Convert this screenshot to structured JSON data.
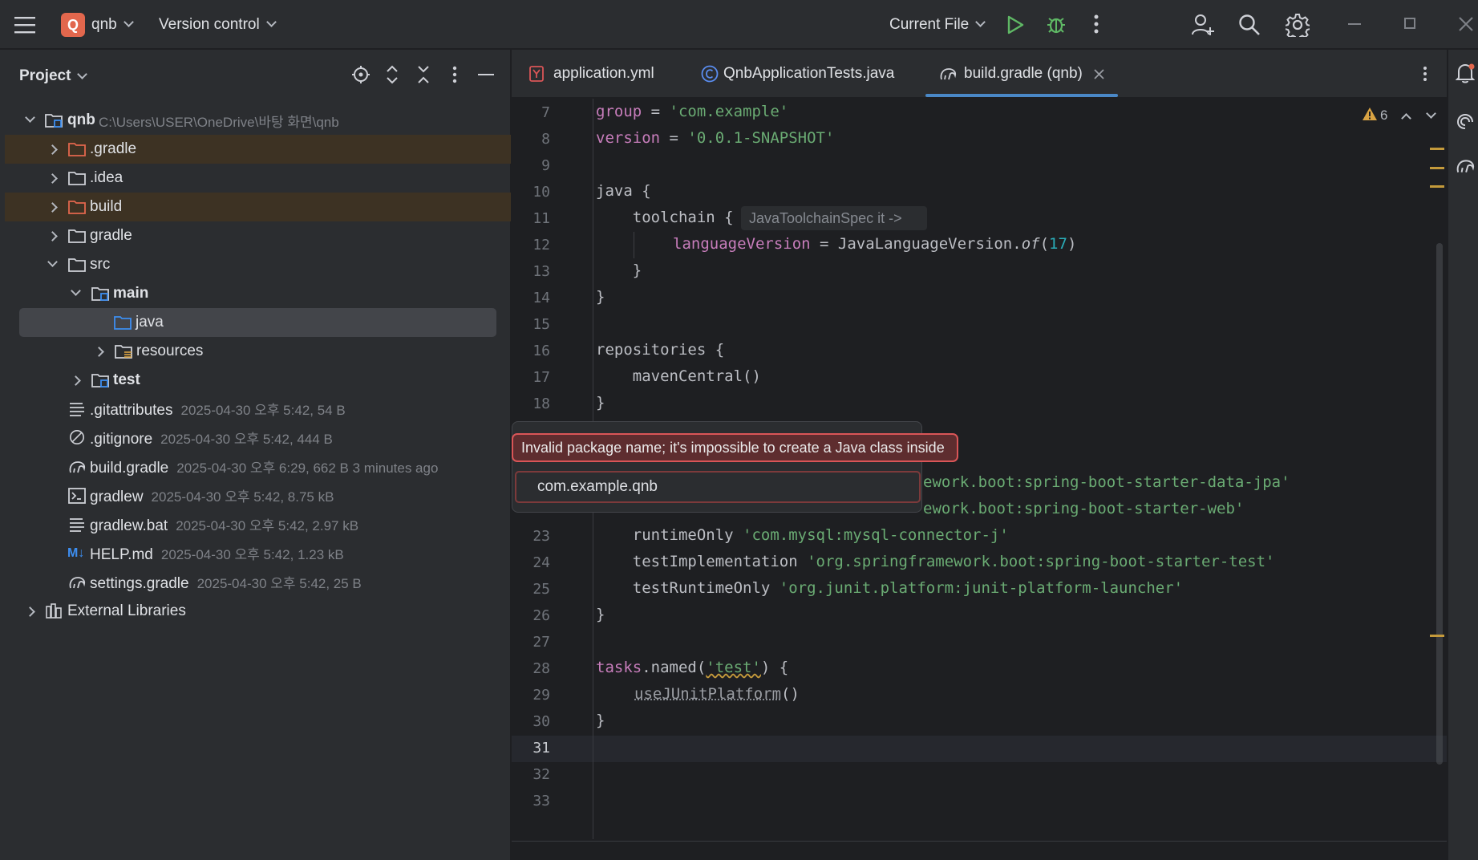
{
  "titlebar": {
    "project_initial": "Q",
    "project_name": "qnb",
    "version_control": "Version control",
    "run_config": "Current File"
  },
  "project_panel": {
    "title": "Project",
    "root": {
      "name": "qnb",
      "path": "C:\\Users\\USER\\OneDrive\\바탕 화면\\qnb"
    },
    "items": [
      {
        "label": ".gradle"
      },
      {
        "label": ".idea"
      },
      {
        "label": "build"
      },
      {
        "label": "gradle"
      },
      {
        "label": "src"
      },
      {
        "label": "main"
      },
      {
        "label": "java"
      },
      {
        "label": "resources"
      },
      {
        "label": "test"
      },
      {
        "label": ".gitattributes",
        "meta": "2025-04-30 오후 5:42, 54 B"
      },
      {
        "label": ".gitignore",
        "meta": "2025-04-30 오후 5:42, 444 B"
      },
      {
        "label": "build.gradle",
        "meta": "2025-04-30 오후 6:29, 662 B 3 minutes ago"
      },
      {
        "label": "gradlew",
        "meta": "2025-04-30 오후 5:42, 8.75 kB"
      },
      {
        "label": "gradlew.bat",
        "meta": "2025-04-30 오후 5:42, 2.97 kB"
      },
      {
        "label": "HELP.md",
        "meta": "2025-04-30 오후 5:42, 1.23 kB"
      },
      {
        "label": "settings.gradle",
        "meta": "2025-04-30 오후 5:42, 25 B"
      },
      {
        "label": "External Libraries"
      }
    ],
    "md_badge": "M↓"
  },
  "tabs": [
    {
      "label": "application.yml"
    },
    {
      "label": "QnbApplicationTests.java"
    },
    {
      "label": "build.gradle (qnb)"
    }
  ],
  "editor": {
    "warning_count": "6",
    "inlay_hint": "JavaToolchainSpec it ->",
    "line_numbers": [
      "7",
      "8",
      "9",
      "10",
      "11",
      "12",
      "13",
      "14",
      "15",
      "16",
      "17",
      "18",
      "23",
      "24",
      "25",
      "26",
      "27",
      "28",
      "29",
      "30",
      "31",
      "32",
      "33"
    ],
    "code": {
      "l7a": "group",
      "l7b": " = ",
      "l7c": "'com.example'",
      "l8a": "version",
      "l8b": " = ",
      "l8c": "'0.0.1-SNAPSHOT'",
      "l10": "java {",
      "l11": "    toolchain {",
      "l12a": "languageVersion",
      "l12b": " = JavaLanguageVersion.",
      "l12c": "of",
      "l12d": "(",
      "l12e": "17",
      "l12f": ")",
      "l13": "    }",
      "l14": "}",
      "l16": "repositories {",
      "l17": "    mavenCentral()",
      "l18": "}",
      "l21": "ework.boot:spring-boot-starter-data-jpa'",
      "l22": "ework.boot:spring-boot-starter-web'",
      "l23a": "    runtimeOnly ",
      "l23b": "'com.mysql:mysql-connector-j'",
      "l24a": "    testImplementation ",
      "l24b": "'org.springframework.boot:spring-boot-starter-test'",
      "l25a": "    testRuntimeOnly ",
      "l25b": "'org.junit.platform:junit-platform-launcher'",
      "l26": "}",
      "l28a": "tasks",
      "l28b": ".named(",
      "l28c": "'test'",
      "l28d": ") {",
      "l29": "useJUnitPlatform",
      "l29b": "()",
      "l30": "}"
    }
  },
  "popup": {
    "error": "Invalid package name; it's impossible to create a Java class inside",
    "input_value": "com.example.qnb"
  }
}
